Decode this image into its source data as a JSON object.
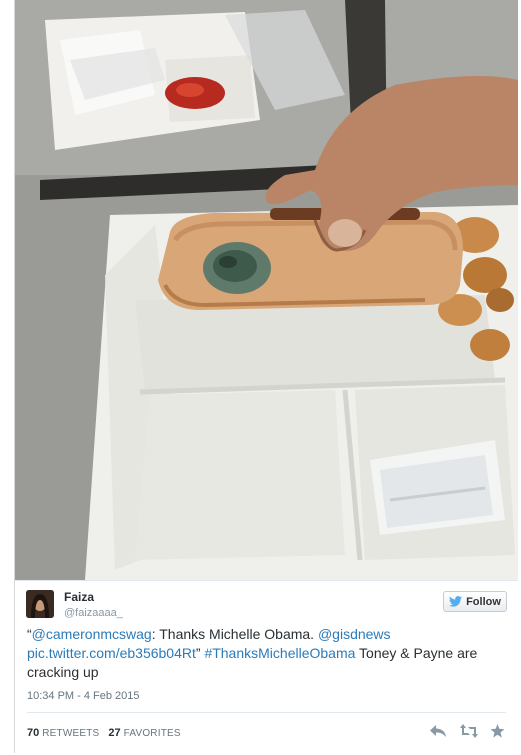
{
  "tweet": {
    "author_name": "Faiza",
    "author_handle": "@faizaaaa_",
    "follow_label": "Follow",
    "text": {
      "open_quote": "“",
      "mention1": "@cameronmcswag",
      "part1": ": Thanks Michelle Obama. ",
      "mention2": "@gisdnews",
      "link": "pic.twitter.com/eb356b04Rt",
      "close_quote": "” ",
      "hashtag": "#ThanksMichelleObama",
      "part2": " Toney & Payne are cracking up"
    },
    "timestamp": "10:34 PM - 4 Feb 2015",
    "retweets_count": "70",
    "retweets_label": "RETWEETS",
    "favorites_count": "27",
    "favorites_label": "FAVORITES"
  },
  "icons": {
    "follow": "twitter-bird-icon",
    "reply": "reply-icon",
    "retweet": "retweet-icon",
    "favorite": "star-icon"
  },
  "colors": {
    "link": "#2b7bb9",
    "twitter_blue": "#55acee",
    "muted": "#8899a6"
  }
}
